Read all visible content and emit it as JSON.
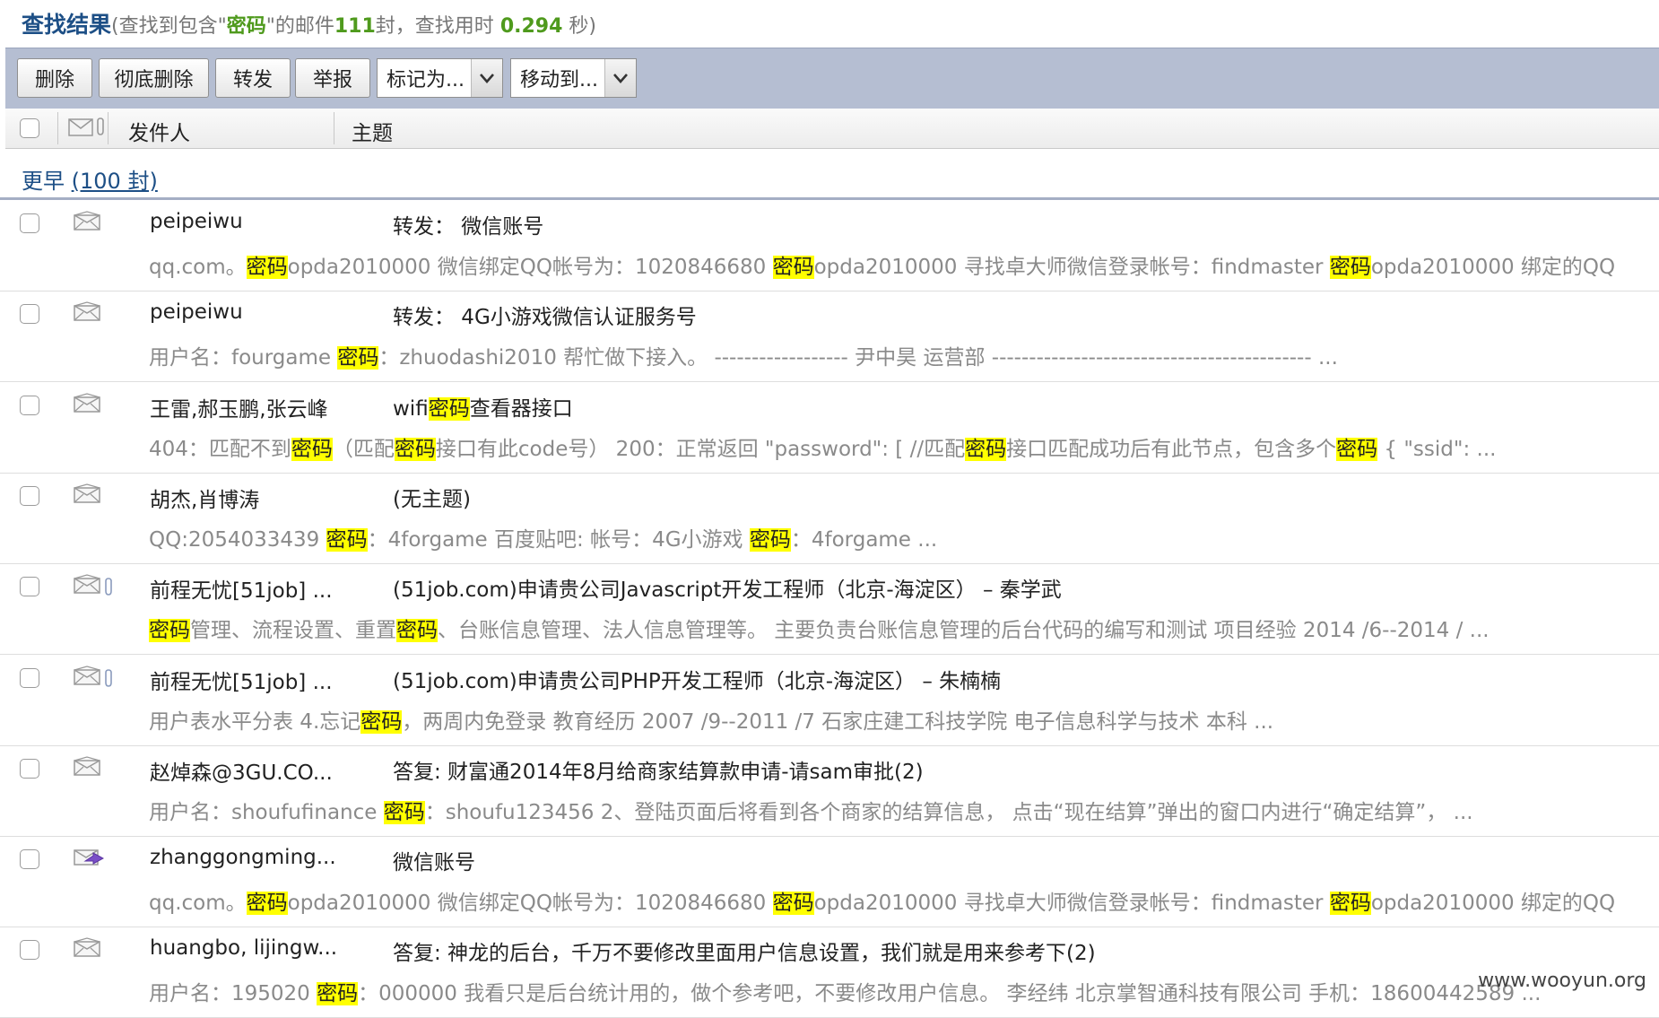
{
  "title": {
    "main": "查找结果",
    "info_prefix": "(查找到包含\"",
    "keyword": "密码",
    "info_mid": "\"的邮件",
    "count": "111",
    "info_mid2": "封，查找用时",
    "time": "0.294",
    "info_suffix": "秒)"
  },
  "toolbar": {
    "delete": "删除",
    "perm_delete": "彻底删除",
    "forward": "转发",
    "report": "举报",
    "mark_as": "标记为...",
    "move_to": "移动到..."
  },
  "header": {
    "sender": "发件人",
    "subject": "主题"
  },
  "group": {
    "label": "更早",
    "count_text": "(100 封)"
  },
  "colors": {
    "highlight": "#ffff00",
    "title": "#1d4f86",
    "toolbar_bg": "#b5bed2",
    "green": "#4f9a1d"
  },
  "watermark": "www.wooyun.org",
  "rows": [
    {
      "icon": "envelope-read-icon",
      "attachment": false,
      "sender": "peipeiwu",
      "subject": [
        {
          "t": "转发：  微信账号"
        }
      ],
      "snippet": [
        {
          "t": "qq.com。"
        },
        {
          "t": "密码",
          "h": true
        },
        {
          "t": "opda2010000 微信绑定QQ帐号为：1020846680 "
        },
        {
          "t": "密码",
          "h": true
        },
        {
          "t": "opda2010000 寻找卓大师微信登录帐号：findmaster "
        },
        {
          "t": "密码",
          "h": true
        },
        {
          "t": "opda2010000 绑定的QQ"
        }
      ]
    },
    {
      "icon": "envelope-read-icon",
      "attachment": false,
      "sender": "peipeiwu",
      "subject": [
        {
          "t": "转发：  4G小游戏微信认证服务号"
        }
      ],
      "snippet": [
        {
          "t": "用户名：fourgame "
        },
        {
          "t": "密码",
          "h": true
        },
        {
          "t": "：zhuodashi2010 帮忙做下接入。 ------------------ 尹中昊 运营部 ------------------------------------------- ..."
        }
      ]
    },
    {
      "icon": "envelope-read-icon",
      "attachment": false,
      "sender": "王雷,郝玉鹏,张云峰",
      "subject": [
        {
          "t": "wifi"
        },
        {
          "t": "密码",
          "h": true
        },
        {
          "t": "查看器接口"
        }
      ],
      "snippet": [
        {
          "t": "404：匹配不到"
        },
        {
          "t": "密码",
          "h": true
        },
        {
          "t": "（匹配"
        },
        {
          "t": "密码",
          "h": true
        },
        {
          "t": "接口有此code号） 200：正常返回 \"password\": [ //匹配"
        },
        {
          "t": "密码",
          "h": true
        },
        {
          "t": "接口匹配成功后有此节点，包含多个"
        },
        {
          "t": "密码",
          "h": true
        },
        {
          "t": " { \"ssid\": ..."
        }
      ]
    },
    {
      "icon": "envelope-read-icon",
      "attachment": false,
      "sender": "胡杰,肖博涛",
      "subject": [
        {
          "t": "(无主题)"
        }
      ],
      "snippet": [
        {
          "t": "QQ:2054033439 "
        },
        {
          "t": "密码",
          "h": true
        },
        {
          "t": "：4forgame 百度贴吧: 帐号：4G小游戏 "
        },
        {
          "t": "密码",
          "h": true
        },
        {
          "t": "：4forgame ..."
        }
      ]
    },
    {
      "icon": "envelope-read-icon",
      "attachment": true,
      "sender": "前程无忧[51job] ...",
      "subject": [
        {
          "t": "(51job.com)申请贵公司Javascript开发工程师（北京-海淀区） – 秦学武"
        }
      ],
      "snippet": [
        {
          "t": "密码",
          "h": true
        },
        {
          "t": "管理、流程设置、重置"
        },
        {
          "t": "密码",
          "h": true
        },
        {
          "t": "、台账信息管理、法人信息管理等。 主要负责台账信息管理的后台代码的编写和测试 项目经验 2014 /6--2014 / ..."
        }
      ]
    },
    {
      "icon": "envelope-read-icon",
      "attachment": true,
      "sender": "前程无忧[51job] ...",
      "subject": [
        {
          "t": "(51job.com)申请贵公司PHP开发工程师（北京-海淀区） – 朱楠楠"
        }
      ],
      "snippet": [
        {
          "t": "用户表水平分表 4.忘记"
        },
        {
          "t": "密码",
          "h": true
        },
        {
          "t": "，两周内免登录 教育经历 2007 /9--2011 /7 石家庄建工科技学院 电子信息科学与技术 本科 ..."
        }
      ]
    },
    {
      "icon": "envelope-read-icon",
      "attachment": false,
      "sender": "赵焯森@3GU.CO...",
      "subject": [
        {
          "t": "答复: 财富通2014年8月给商家结算款申请-请sam审批(2)"
        }
      ],
      "snippet": [
        {
          "t": "用户名：shoufufinance "
        },
        {
          "t": "密码",
          "h": true
        },
        {
          "t": "：shoufu123456 2、登陆页面后将看到各个商家的结算信息， 点击“现在结算”弹出的窗口内进行“确定结算”， ..."
        }
      ]
    },
    {
      "icon": "envelope-forwarded-icon",
      "attachment": false,
      "sender": "zhanggongming...",
      "subject": [
        {
          "t": "微信账号"
        }
      ],
      "snippet": [
        {
          "t": "qq.com。"
        },
        {
          "t": "密码",
          "h": true
        },
        {
          "t": "opda2010000 微信绑定QQ帐号为：1020846680 "
        },
        {
          "t": "密码",
          "h": true
        },
        {
          "t": "opda2010000 寻找卓大师微信登录帐号：findmaster "
        },
        {
          "t": "密码",
          "h": true
        },
        {
          "t": "opda2010000 绑定的QQ"
        }
      ]
    },
    {
      "icon": "envelope-read-icon",
      "attachment": false,
      "sender": "huangbo, lijingw...",
      "subject": [
        {
          "t": "答复: 神龙的后台，千万不要修改里面用户信息设置，我们就是用来参考下(2)"
        }
      ],
      "snippet": [
        {
          "t": "用户名：195020 "
        },
        {
          "t": "密码",
          "h": true
        },
        {
          "t": "：000000 我看只是后台统计用的，做个参考吧，不要修改用户信息。 李经纬 北京掌智通科技有限公司 手机：18600442589 ..."
        }
      ]
    }
  ]
}
